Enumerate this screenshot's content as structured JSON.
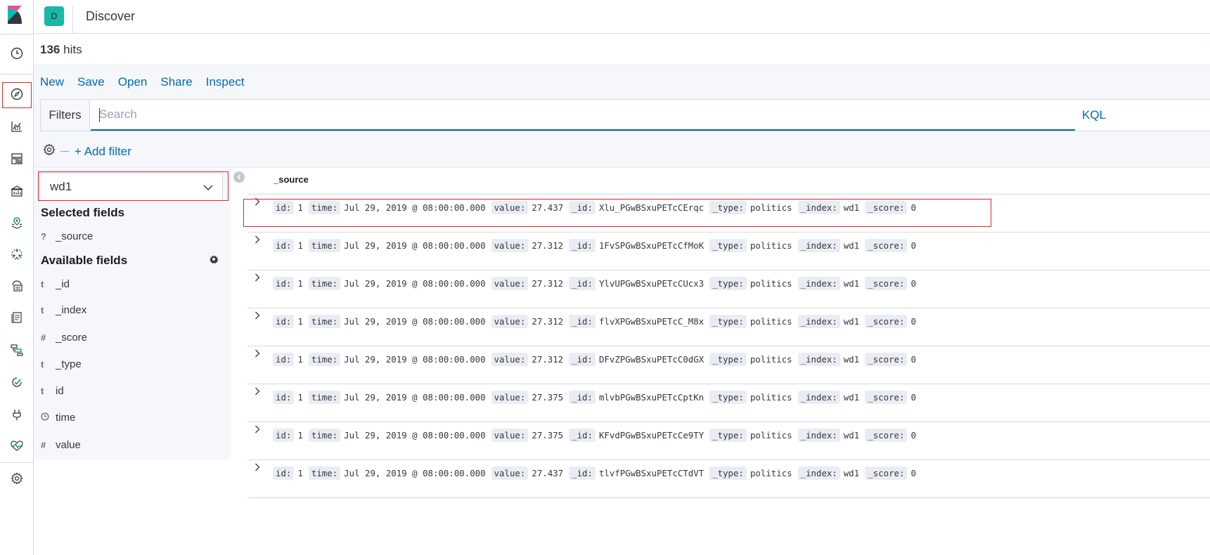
{
  "header": {
    "space_letter": "D",
    "title": "Discover"
  },
  "hits": {
    "count": "136",
    "label": "hits"
  },
  "menu": [
    "New",
    "Save",
    "Open",
    "Share",
    "Inspect"
  ],
  "filters": {
    "label": "Filters",
    "search_placeholder": "Search",
    "language": "KQL",
    "add_filter": "+ Add filter"
  },
  "sidebar": {
    "index_pattern": "wd1",
    "selected_heading": "Selected fields",
    "selected_fields": [
      {
        "type": "?",
        "name": "_source"
      }
    ],
    "available_heading": "Available fields",
    "available_fields": [
      {
        "type": "t",
        "name": "_id"
      },
      {
        "type": "t",
        "name": "_index"
      },
      {
        "type": "#",
        "name": "_score"
      },
      {
        "type": "t",
        "name": "_type"
      },
      {
        "type": "t",
        "name": "id"
      },
      {
        "type": "clock",
        "name": "time"
      },
      {
        "type": "#",
        "name": "value"
      }
    ]
  },
  "table": {
    "column": "_source",
    "keys": [
      "id:",
      "time:",
      "value:",
      "_id:",
      "_type:",
      "_index:",
      "_score:"
    ],
    "rows": [
      [
        "1",
        "Jul 29, 2019 @ 08:00:00.000",
        "27.437",
        "Xlu_PGwBSxuPETcCErqc",
        "politics",
        "wd1",
        "0"
      ],
      [
        "1",
        "Jul 29, 2019 @ 08:00:00.000",
        "27.312",
        "1FvSPGwBSxuPETcCfMoK",
        "politics",
        "wd1",
        "0"
      ],
      [
        "1",
        "Jul 29, 2019 @ 08:00:00.000",
        "27.312",
        "YlvUPGwBSxuPETcCUcx3",
        "politics",
        "wd1",
        "0"
      ],
      [
        "1",
        "Jul 29, 2019 @ 08:00:00.000",
        "27.312",
        "flvXPGwBSxuPETcC_M8x",
        "politics",
        "wd1",
        "0"
      ],
      [
        "1",
        "Jul 29, 2019 @ 08:00:00.000",
        "27.312",
        "DFvZPGwBSxuPETcC0dGX",
        "politics",
        "wd1",
        "0"
      ],
      [
        "1",
        "Jul 29, 2019 @ 08:00:00.000",
        "27.375",
        "mlvbPGwBSxuPETcCptKn",
        "politics",
        "wd1",
        "0"
      ],
      [
        "1",
        "Jul 29, 2019 @ 08:00:00.000",
        "27.375",
        "KFvdPGwBSxuPETcCe9TY",
        "politics",
        "wd1",
        "0"
      ],
      [
        "1",
        "Jul 29, 2019 @ 08:00:00.000",
        "27.437",
        "tlvfPGwBSxuPETcCTdVT",
        "politics",
        "wd1",
        "0"
      ]
    ]
  },
  "colors": {
    "accent": "#006bb4",
    "highlight": "#e0242b",
    "space": "#16b9a5"
  },
  "nav_icons": [
    "kibana-logo-icon",
    "recent-clock-icon",
    "discover-compass-icon",
    "visualize-icon",
    "dashboard-icon",
    "canvas-icon",
    "maps-icon",
    "ml-icon",
    "infrastructure-icon",
    "logs-icon",
    "apm-icon",
    "uptime-icon",
    "dev-tools-icon",
    "monitoring-icon",
    "management-gear-icon"
  ]
}
